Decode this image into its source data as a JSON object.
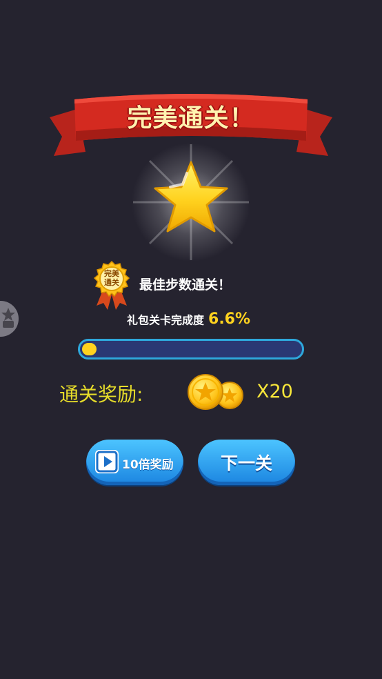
{
  "title": "完美通关！",
  "medal": {
    "line1": "完美",
    "line2": "通关"
  },
  "best_steps_text": "最佳步数通关！",
  "gift_progress": {
    "label": "礼包关卡完成度",
    "value_text": "6.6%",
    "fraction": 0.066
  },
  "reward": {
    "label": "通关奖励:",
    "count_text": "X20",
    "icon": "coin-icon"
  },
  "buttons": {
    "video_reward": "10倍奖励",
    "next_level": "下一关"
  },
  "colors": {
    "background": "#25232f",
    "accent_yellow": "#ffd21f",
    "ribbon_red": "#d42a20",
    "button_blue": "#2aa0f0"
  }
}
